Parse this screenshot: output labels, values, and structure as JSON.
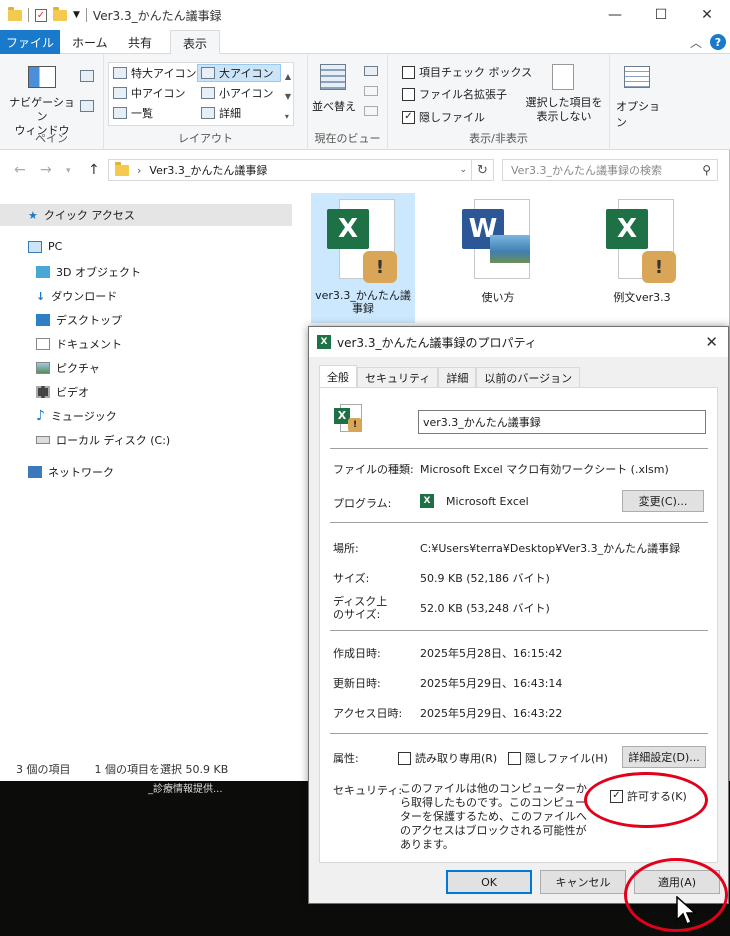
{
  "window": {
    "title": "Ver3.3_かんたん議事録"
  },
  "menu": {
    "file": "ファイル",
    "home": "ホーム",
    "share": "共有",
    "view": "表示"
  },
  "ribbon": {
    "nav_pane_label": "ナビゲーション\nウィンドウ",
    "pane_group": "ペイン",
    "layout_group": "レイアウト",
    "layout_items": [
      "特大アイコン",
      "大アイコン",
      "中アイコン",
      "小アイコン",
      "一覧",
      "詳細"
    ],
    "sort_label": "並べ替え",
    "current_view_group": "現在のビュー",
    "checkboxes": [
      {
        "label": "項目チェック ボックス",
        "checked": false
      },
      {
        "label": "ファイル名拡張子",
        "checked": false
      },
      {
        "label": "隠しファイル",
        "checked": true
      }
    ],
    "hide_selected": "選択した項目を\n表示しない",
    "show_hide_group": "表示/非表示",
    "options": "オプション"
  },
  "address": {
    "path": "Ver3.3_かんたん議事録",
    "search_placeholder": "Ver3.3_かんたん議事録の検索"
  },
  "nav": {
    "quick_access": "クイック アクセス",
    "pc": "PC",
    "items": [
      "3D オブジェクト",
      "ダウンロード",
      "デスクトップ",
      "ドキュメント",
      "ピクチャ",
      "ビデオ",
      "ミュージック",
      "ローカル ディスク (C:)"
    ],
    "network": "ネットワーク"
  },
  "files": [
    {
      "name": "ver3.3_かんたん議事録",
      "type": "excel",
      "selected": true
    },
    {
      "name": "使い方",
      "type": "word",
      "selected": false
    },
    {
      "name": "例文ver3.3",
      "type": "excel",
      "selected": false
    }
  ],
  "status": {
    "count": "3 個の項目",
    "selected": "1 個の項目を選択  50.9 KB"
  },
  "background_text": "_診療情報提供...",
  "dialog": {
    "title": "ver3.3_かんたん議事録のプロパティ",
    "tabs": [
      "全般",
      "セキュリティ",
      "詳細",
      "以前のバージョン"
    ],
    "name": "ver3.3_かんたん議事録",
    "file_type_label": "ファイルの種類:",
    "file_type": "Microsoft Excel マクロ有効ワークシート (.xlsm)",
    "program_label": "プログラム:",
    "program": "Microsoft Excel",
    "change_button": "変更(C)...",
    "location_label": "場所:",
    "location": "C:¥Users¥terra¥Desktop¥Ver3.3_かんたん議事録",
    "size_label": "サイズ:",
    "size": "50.9 KB (52,186 バイト)",
    "disk_size_label": "ディスク上\nのサイズ:",
    "disk_size": "52.0 KB (53,248 バイト)",
    "created_label": "作成日時:",
    "created": "2025年5月28日、16:15:42",
    "modified_label": "更新日時:",
    "modified": "2025年5月29日、16:43:14",
    "accessed_label": "アクセス日時:",
    "accessed": "2025年5月29日、16:43:22",
    "attributes_label": "属性:",
    "readonly": "読み取り専用(R)",
    "hidden": "隠しファイル(H)",
    "advanced_button": "詳細設定(D)...",
    "security_label": "セキュリティ:",
    "security_note": "このファイルは他のコンピューターから取得したものです。このコンピューターを保護するため、このファイルへのアクセスはブロックされる可能性があります。",
    "unblock": "許可する(K)",
    "unblock_checked": true,
    "ok": "OK",
    "cancel": "キャンセル",
    "apply": "適用(A)"
  },
  "colors": {
    "accent": "#1979ca",
    "excel": "#1e7145",
    "word": "#2b5797",
    "highlight": "#e3001b"
  }
}
